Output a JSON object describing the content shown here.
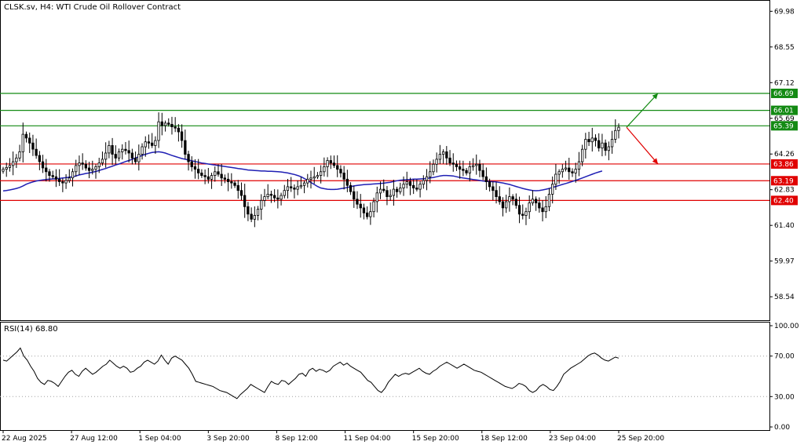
{
  "header": {
    "title": "CLSK.sv, H4:  WTI Crude Oil Rollover Contract"
  },
  "colors": {
    "bull": "#ffffff",
    "bear": "#000000",
    "ma": "#1f1fb4",
    "resistance": "#138a13",
    "support": "#e00000",
    "rsi_line": "#000000",
    "grid_dots": "#a0a0a0"
  },
  "chart_data": [
    {
      "type": "candlestick",
      "title": "CLSK.sv, H4:  WTI Crude Oil Rollover Contract",
      "x": [
        "22 Aug 2025",
        "27 Aug 12:00",
        "1 Sep 04:00",
        "3 Sep 20:00",
        "8 Sep 12:00",
        "11 Sep 04:00",
        "15 Sep 20:00",
        "18 Sep 12:00",
        "23 Sep 04:00",
        "25 Sep 20:00"
      ],
      "ylim": [
        57.6,
        70.4
      ],
      "yticks": [
        69.98,
        68.55,
        67.12,
        65.69,
        64.26,
        62.83,
        61.4,
        59.97,
        58.54
      ],
      "horizontal_levels": {
        "resistance": [
          66.69,
          66.01,
          65.39
        ],
        "support": [
          63.86,
          63.19,
          62.4
        ]
      },
      "annotations": [
        "up arrow to 66.69 (green)",
        "down arrow to 63.86 (red)"
      ],
      "closes": [
        63.65,
        63.72,
        63.8,
        63.95,
        64.1,
        64.35,
        65.05,
        64.9,
        64.7,
        64.45,
        64.2,
        63.95,
        63.7,
        63.55,
        63.4,
        63.35,
        63.25,
        63.15,
        63.1,
        63.2,
        63.3,
        63.55,
        63.8,
        63.9,
        63.85,
        63.7,
        63.6,
        63.65,
        63.75,
        63.9,
        64.05,
        64.3,
        64.6,
        64.25,
        64.1,
        64.35,
        64.45,
        64.4,
        64.3,
        64.1,
        63.95,
        64.25,
        64.55,
        64.75,
        64.7,
        64.6,
        64.8,
        65.55,
        65.4,
        65.5,
        65.45,
        65.35,
        65.3,
        65.15,
        64.8,
        64.25,
        63.95,
        63.75,
        63.65,
        63.5,
        63.4,
        63.35,
        63.25,
        63.4,
        63.55,
        63.45,
        63.3,
        63.25,
        63.15,
        63.1,
        63.0,
        62.8,
        62.6,
        62.15,
        61.85,
        61.65,
        61.8,
        62.05,
        62.4,
        62.55,
        62.65,
        62.6,
        62.5,
        62.45,
        62.6,
        62.8,
        62.95,
        62.9,
        62.85,
        62.95,
        63.0,
        63.1,
        63.25,
        63.3,
        63.35,
        63.4,
        63.55,
        63.75,
        64.0,
        63.9,
        63.8,
        63.65,
        63.5,
        63.25,
        63.0,
        62.75,
        62.45,
        62.25,
        62.1,
        61.9,
        61.75,
        61.95,
        62.35,
        62.7,
        62.85,
        62.8,
        62.55,
        62.6,
        62.85,
        62.75,
        62.9,
        63.05,
        63.15,
        63.0,
        62.9,
        62.85,
        63.05,
        63.2,
        63.35,
        63.55,
        63.85,
        64.05,
        64.25,
        64.35,
        64.1,
        63.9,
        63.85,
        63.75,
        63.65,
        63.6,
        63.5,
        63.75,
        63.8,
        63.85,
        63.6,
        63.35,
        63.15,
        62.95,
        62.8,
        62.55,
        62.35,
        62.1,
        62.35,
        62.55,
        62.45,
        62.2,
        61.85,
        61.8,
        61.95,
        62.3,
        62.45,
        62.3,
        62.1,
        61.95,
        62.15,
        62.65,
        63.05,
        63.45,
        63.55,
        63.65,
        63.7,
        63.55,
        63.5,
        63.65,
        63.95,
        64.45,
        64.85,
        64.75,
        64.9,
        64.8,
        64.5,
        64.7,
        64.4,
        64.55,
        64.85,
        65.2,
        65.33
      ],
      "series": [
        {
          "name": "",
          "values": [
            62.78,
            62.8,
            62.82,
            62.85,
            62.88,
            62.92,
            62.98,
            63.05,
            63.1,
            63.14,
            63.18,
            63.2,
            63.22,
            63.24,
            63.25,
            63.26,
            63.27,
            63.28,
            63.3,
            63.31,
            63.33,
            63.35,
            63.38,
            63.42,
            63.45,
            63.48,
            63.5,
            63.53,
            63.56,
            63.6,
            63.64,
            63.68,
            63.73,
            63.77,
            63.82,
            63.86,
            63.91,
            63.96,
            64.0,
            64.05,
            64.1,
            64.15,
            64.2,
            64.25,
            64.29,
            64.32,
            64.34,
            64.35,
            64.33,
            64.3,
            64.25,
            64.2,
            64.16,
            64.12,
            64.08,
            64.05,
            64.02,
            63.99,
            63.96,
            63.93,
            63.9,
            63.88,
            63.86,
            63.84,
            63.82,
            63.8,
            63.78,
            63.76,
            63.74,
            63.72,
            63.7,
            63.68,
            63.66,
            63.64,
            63.62,
            63.61,
            63.6,
            63.59,
            63.58,
            63.58,
            63.57,
            63.57,
            63.56,
            63.55,
            63.54,
            63.52,
            63.5,
            63.47,
            63.44,
            63.4,
            63.35,
            63.28,
            63.2,
            63.12,
            63.04,
            62.96,
            62.9,
            62.87,
            62.85,
            62.84,
            62.84,
            62.85,
            62.87,
            62.89,
            62.92,
            62.95,
            62.98,
            63.0,
            63.02,
            63.03,
            63.04,
            63.05,
            63.06,
            63.07,
            63.08,
            63.09,
            63.11,
            63.13,
            63.16,
            63.19,
            63.21,
            63.22,
            63.23,
            63.24,
            63.25,
            63.25,
            63.26,
            63.27,
            63.28,
            63.3,
            63.32,
            63.35,
            63.38,
            63.4,
            63.4,
            63.39,
            63.38,
            63.35,
            63.32,
            63.3,
            63.28,
            63.26,
            63.24,
            63.22,
            63.2,
            63.18,
            63.17,
            63.16,
            63.15,
            63.14,
            63.12,
            63.1,
            63.07,
            63.04,
            63.0,
            62.96,
            62.92,
            62.88,
            62.85,
            62.82,
            62.8,
            62.79,
            62.8,
            62.82,
            62.85,
            62.88,
            62.92,
            62.96,
            63.0,
            63.04,
            63.08,
            63.12,
            63.16,
            63.2,
            63.25,
            63.3,
            63.35,
            63.4,
            63.45,
            63.5,
            63.54,
            63.58
          ]
        }
      ],
      "current_price": 65.33
    },
    {
      "type": "line",
      "title": "RSI(14) 68.80",
      "ylim": [
        0,
        100
      ],
      "yticks": [
        100.0,
        70.0,
        30.0,
        0.0
      ],
      "levels": [
        70,
        30
      ],
      "series": [
        {
          "name": "RSI(14)",
          "values": [
            66,
            65,
            68,
            71,
            74,
            78,
            70,
            66,
            60,
            55,
            48,
            44,
            42,
            46,
            45,
            43,
            40,
            45,
            50,
            54,
            56,
            52,
            50,
            55,
            58,
            55,
            52,
            54,
            57,
            60,
            62,
            66,
            63,
            60,
            58,
            60,
            58,
            54,
            55,
            58,
            60,
            64,
            66,
            64,
            62,
            65,
            71,
            66,
            62,
            68,
            70,
            68,
            66,
            62,
            58,
            52,
            45,
            44,
            43,
            42,
            41,
            40,
            38,
            36,
            35,
            34,
            32,
            30,
            28,
            32,
            35,
            38,
            42,
            40,
            38,
            36,
            34,
            40,
            45,
            43,
            42,
            46,
            45,
            42,
            45,
            48,
            52,
            53,
            50,
            56,
            58,
            55,
            57,
            56,
            54,
            56,
            60,
            62,
            64,
            61,
            63,
            60,
            58,
            56,
            54,
            50,
            46,
            44,
            40,
            36,
            34,
            38,
            44,
            48,
            52,
            50,
            52,
            53,
            52,
            54,
            56,
            58,
            55,
            53,
            52,
            55,
            57,
            60,
            62,
            64,
            62,
            60,
            58,
            60,
            62,
            60,
            58,
            56,
            55,
            54,
            52,
            50,
            48,
            46,
            44,
            42,
            40,
            39,
            38,
            40,
            43,
            42,
            40,
            36,
            34,
            36,
            40,
            42,
            40,
            37,
            36,
            40,
            45,
            52,
            55,
            58,
            60,
            62,
            64,
            67,
            70,
            72,
            73,
            71,
            68,
            66,
            65,
            67,
            69,
            68
          ]
        }
      ]
    }
  ]
}
